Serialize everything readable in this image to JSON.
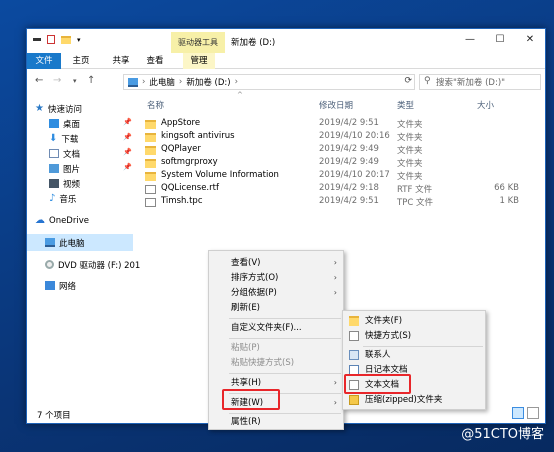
{
  "window": {
    "title": "新加卷 (D:)",
    "context_tab_head": "驱动器工具",
    "buttons": {
      "minimize": "—",
      "maximize": "☐",
      "close": "✕"
    }
  },
  "ribbon": {
    "tabs": [
      {
        "label": "文件"
      },
      {
        "label": "主页"
      },
      {
        "label": "共享"
      },
      {
        "label": "查看"
      },
      {
        "label": "管理"
      }
    ]
  },
  "address": {
    "crumbs": [
      "此电脑",
      "新加卷 (D:)"
    ],
    "search_placeholder": "搜索\"新加卷 (D:)\""
  },
  "navpane": {
    "items": [
      {
        "label": "快速访问"
      },
      {
        "label": "桌面"
      },
      {
        "label": "下载"
      },
      {
        "label": "文档"
      },
      {
        "label": "图片"
      },
      {
        "label": "视频"
      },
      {
        "label": "音乐"
      },
      {
        "label": "OneDrive"
      },
      {
        "label": "此电脑"
      },
      {
        "label": "DVD 驱动器 (F:) 201"
      },
      {
        "label": "网络"
      }
    ]
  },
  "list": {
    "headers": {
      "name": "名称",
      "date": "修改日期",
      "type": "类型",
      "size": "大小"
    },
    "rows": [
      {
        "name": "AppStore",
        "date": "2019/4/2 9:51",
        "type": "文件夹",
        "size": ""
      },
      {
        "name": "kingsoft antivirus",
        "date": "2019/4/10 20:16",
        "type": "文件夹",
        "size": ""
      },
      {
        "name": "QQPlayer",
        "date": "2019/4/2 9:49",
        "type": "文件夹",
        "size": ""
      },
      {
        "name": "softmgrproxy",
        "date": "2019/4/2 9:49",
        "type": "文件夹",
        "size": ""
      },
      {
        "name": "System Volume Information",
        "date": "2019/4/10 20:17",
        "type": "文件夹",
        "size": ""
      },
      {
        "name": "QQLicense.rtf",
        "date": "2019/4/2 9:18",
        "type": "RTF 文件",
        "size": "66 KB"
      },
      {
        "name": "Timsh.tpc",
        "date": "2019/4/2 9:51",
        "type": "TPC 文件",
        "size": "1 KB"
      }
    ]
  },
  "status": {
    "count": "7 个项目"
  },
  "context_menu": {
    "items": [
      {
        "label": "查看(V)"
      },
      {
        "label": "排序方式(O)"
      },
      {
        "label": "分组依据(P)"
      },
      {
        "label": "刷新(E)"
      },
      {
        "label": "自定义文件夹(F)..."
      },
      {
        "label": "粘贴(P)"
      },
      {
        "label": "粘贴快捷方式(S)"
      },
      {
        "label": "共享(H)"
      },
      {
        "label": "新建(W)"
      },
      {
        "label": "属性(R)"
      }
    ]
  },
  "submenu": {
    "items": [
      {
        "label": "文件夹(F)"
      },
      {
        "label": "快捷方式(S)"
      },
      {
        "label": "联系人"
      },
      {
        "label": "日记本文档"
      },
      {
        "label": "文本文档"
      },
      {
        "label": "压缩(zipped)文件夹"
      }
    ]
  },
  "watermark": "@51CTO博客",
  "colors": {
    "accent": "#1979ca",
    "highlight": "#e8262a",
    "selection": "#cce8ff"
  }
}
